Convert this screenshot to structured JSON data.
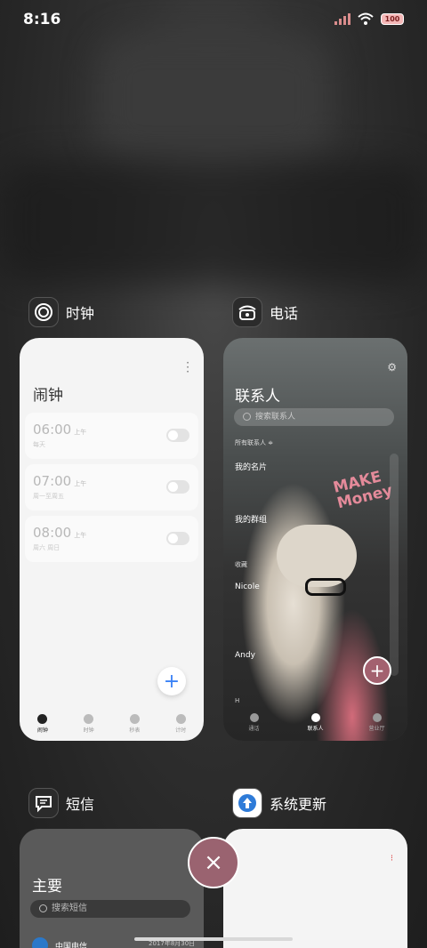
{
  "status_bar": {
    "time": "8:16",
    "battery": "100"
  },
  "apps": {
    "clock": {
      "title": "时钟",
      "heading": "闹钟",
      "alarms": [
        {
          "time": "06:00",
          "ampm": "上午",
          "repeat": "每天",
          "enabled": false
        },
        {
          "time": "07:00",
          "ampm": "上午",
          "repeat": "周一至周五",
          "enabled": false
        },
        {
          "time": "08:00",
          "ampm": "上午",
          "repeat": "周六 周日",
          "enabled": false
        }
      ],
      "add_label": "+",
      "tabs": [
        "闹钟",
        "时钟",
        "秒表",
        "计时"
      ],
      "active_tab": 0
    },
    "phone": {
      "title": "电话",
      "heading": "联系人",
      "search_placeholder": "搜索联系人",
      "filter": "所有联系人 ≑",
      "my_card": "我的名片",
      "my_groups": "我的群组",
      "favorites": "收藏",
      "contacts": [
        "Nicole",
        "Andy"
      ],
      "index_letter": "H",
      "sticker_text": "MAKE Money",
      "add_label": "+",
      "tabs": [
        "通话",
        "联系人",
        "营业厅"
      ],
      "active_tab": 1
    },
    "messages": {
      "title": "短信",
      "heading": "主要",
      "search_placeholder": "搜索短信",
      "first_sender": "中国电信",
      "first_date": "2017年8月30日"
    },
    "update": {
      "title": "系统更新"
    }
  },
  "actions": {
    "close_all_label": "×"
  },
  "colors": {
    "accent_blue": "#3b82f6",
    "close_button": "#9a6370",
    "phone_fab": "#a3616f"
  }
}
